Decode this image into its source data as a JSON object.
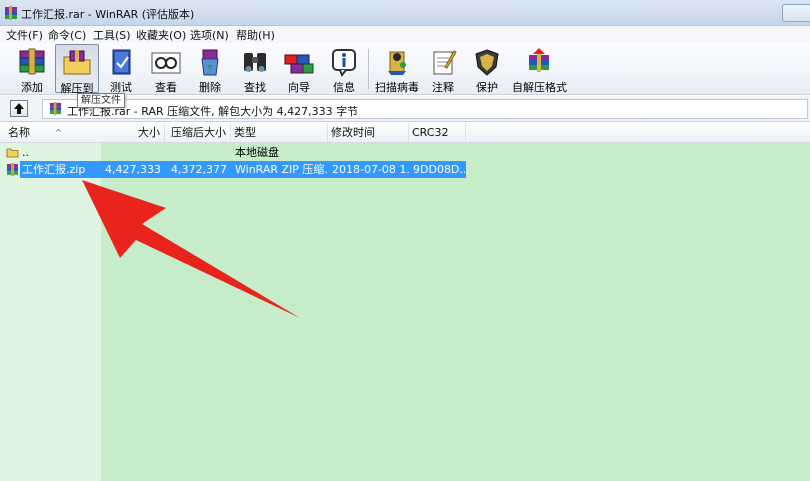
{
  "window": {
    "title": "工作汇报.rar - WinRAR (评估版本)"
  },
  "menu": [
    {
      "label": "文件(F)"
    },
    {
      "label": "命令(C)"
    },
    {
      "label": "工具(S)"
    },
    {
      "label": "收藏夹(O)"
    },
    {
      "label": "选项(N)"
    },
    {
      "label": "帮助(H)"
    }
  ],
  "toolbar": [
    {
      "label": "添加",
      "icon": "books-add-icon"
    },
    {
      "label": "解压到",
      "icon": "folder-extract-icon"
    },
    {
      "label": "测试",
      "icon": "test-book-icon"
    },
    {
      "label": "查看",
      "icon": "view-glasses-icon"
    },
    {
      "label": "删除",
      "icon": "recycle-bin-icon"
    },
    {
      "label": "查找",
      "icon": "binoculars-icon"
    },
    {
      "label": "向导",
      "icon": "wizard-icon"
    },
    {
      "label": "信息",
      "icon": "info-icon"
    },
    {
      "label": "扫描病毒",
      "icon": "virus-scan-icon"
    },
    {
      "label": "注释",
      "icon": "comment-icon"
    },
    {
      "label": "保护",
      "icon": "shield-icon"
    },
    {
      "label": "自解压格式",
      "icon": "sfx-icon"
    }
  ],
  "tooltip": "解压文件",
  "address": {
    "text": "工作汇报.rar - RAR 压缩文件, 解包大小为 4,427,333 字节"
  },
  "columns": {
    "name": "名称",
    "size": "大小",
    "packed": "压缩后大小",
    "type": "类型",
    "modified": "修改时间",
    "crc": "CRC32"
  },
  "rows": [
    {
      "name": "..",
      "size": "",
      "packed": "",
      "type": "本地磁盘",
      "modified": "",
      "crc": "",
      "selected": false
    },
    {
      "name": "工作汇报.zip",
      "size": "4,427,333",
      "packed": "4,372,377",
      "type": "WinRAR ZIP 压缩...",
      "modified": "2018-07-08 1...",
      "crc": "9DD08D...",
      "selected": true
    }
  ],
  "colors": {
    "list_bg": "#c6ecc9",
    "selection": "#3399ff",
    "arrow": "#e8241c"
  }
}
